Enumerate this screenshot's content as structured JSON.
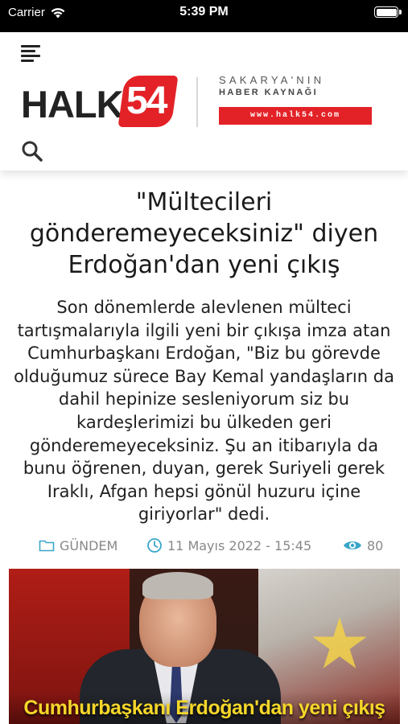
{
  "status_bar": {
    "carrier": "Carrier",
    "time": "5:39 PM",
    "battery_level": 1.0
  },
  "header": {
    "menu_icon": "hamburger-menu-icon",
    "search_icon": "search-icon",
    "logo": {
      "halk": "HALK",
      "number": "54",
      "tagline_top": "SAKARYA'NIN",
      "tagline_bottom": "HABER KAYNAĞI",
      "url": "www.halk54.com",
      "brand_color": "#e32227"
    }
  },
  "article": {
    "title": "\"Mültecileri gönderemeyeceksiniz\" diyen Erdoğan'dan yeni çıkış",
    "body": "Son dönemlerde alevlenen mülteci tartışmalarıyla ilgili yeni bir çıkışa imza atan Cumhurbaşkanı Erdoğan, \"Biz bu görevde olduğumuz sürece Bay Kemal yandaşların da dahil hepinize sesleniyorum siz bu kardeşlerimizi bu ülkeden geri gönderemeyeceksiniz. Şu an itibarıyla da bunu öğrenen, duyan, gerek Suriyeli gerek Iraklı, Afgan hepsi gönül huzuru içine giriyorlar\" dedi.",
    "meta": {
      "category": "GÜNDEM",
      "category_icon": "folder-icon",
      "date": "11 Mayıs 2022 - 15:45",
      "date_icon": "clock-icon",
      "views": "80",
      "views_icon": "eye-icon",
      "icon_color": "#3aa6c9"
    },
    "image_caption": "Cumhurbaşkanı Erdoğan'dan yeni çıkış"
  }
}
